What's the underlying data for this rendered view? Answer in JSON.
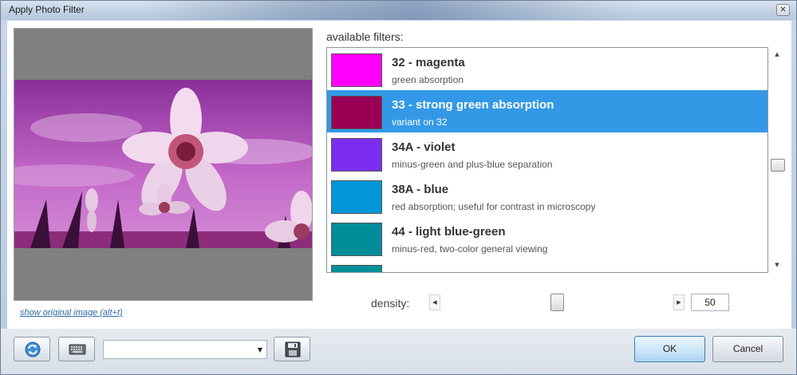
{
  "window": {
    "title": "Apply Photo Filter",
    "close_glyph": "✕"
  },
  "preview": {
    "show_original_link": "show original image (alt+t)"
  },
  "filters": {
    "label": "available filters:",
    "items": [
      {
        "name": "32 - magenta",
        "description": "green absorption",
        "color": "#ff00ff",
        "selected": false
      },
      {
        "name": "33 - strong green absorption",
        "description": "variant on 32",
        "color": "#990055",
        "selected": true
      },
      {
        "name": "34A - violet",
        "description": "minus-green and plus-blue separation",
        "color": "#7c2ef0",
        "selected": false
      },
      {
        "name": "38A - blue",
        "description": "red absorption; useful for contrast in microscopy",
        "color": "#0096d8",
        "selected": false
      },
      {
        "name": "44 - light blue-green",
        "description": "minus-red, two-color general viewing",
        "color": "#008c99",
        "selected": false
      }
    ],
    "partial_next_color": "#00909a"
  },
  "density": {
    "label": "density:",
    "value": "50",
    "slider_fraction": 0.5
  },
  "bottom": {
    "refresh_icon": "refresh-icon",
    "keyboard_icon": "keyboard-icon",
    "save_icon": "floppy-disk-icon",
    "preset_value": "",
    "ok_label": "OK",
    "cancel_label": "Cancel"
  }
}
